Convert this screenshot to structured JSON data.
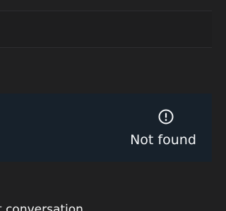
{
  "error": {
    "icon": "exclamation-circle-icon",
    "message": "Not found"
  },
  "footer": {
    "label": "t conversation"
  },
  "colors": {
    "background": "#202021",
    "panel": "#17212b",
    "text": "#f2f4f6"
  }
}
